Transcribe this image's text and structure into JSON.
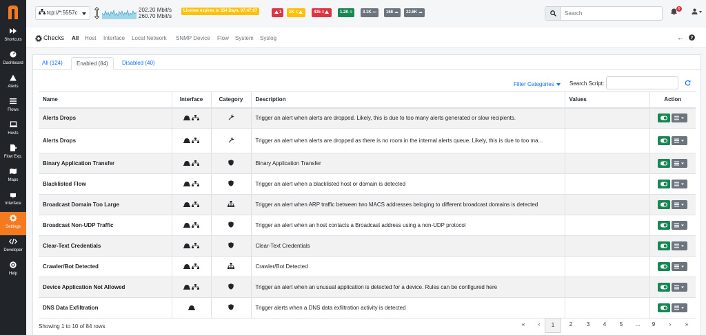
{
  "sidebar": {
    "items": [
      {
        "label": "Shortcuts",
        "icon": "fast-forward-icon"
      },
      {
        "label": "Dashboard",
        "icon": "gauge-icon"
      },
      {
        "label": "Alerts",
        "icon": "warning-icon"
      },
      {
        "label": "Flows",
        "icon": "list-icon"
      },
      {
        "label": "Hosts",
        "icon": "laptop-icon"
      },
      {
        "label": "Flow Exp.",
        "icon": "file-export-icon"
      },
      {
        "label": "Maps",
        "icon": "map-icon"
      },
      {
        "label": "Interface",
        "icon": "ethernet-icon"
      },
      {
        "label": "Settings",
        "icon": "gear-icon"
      },
      {
        "label": "Developer",
        "icon": "code-icon"
      },
      {
        "label": "Help",
        "icon": "lifebuoy-icon"
      }
    ],
    "active": "Settings"
  },
  "topbar": {
    "interface": "tcp://*:5557c",
    "traffic_up": "202.20 Mbit/s",
    "traffic_down": "260.70 Mbit/s",
    "license": "License expires in 354 Days, 07:47:07",
    "badges": [
      "1",
      "1K",
      "435",
      "1.2K",
      "3.1K",
      "168",
      "22.6K"
    ],
    "search_placeholder": "Search",
    "notification_count": "6"
  },
  "nav": {
    "title": "Checks",
    "links": [
      "All",
      "Host",
      "Interface",
      "Local Network",
      "SNMP Device",
      "Flow",
      "System",
      "Syslog"
    ],
    "active": "All"
  },
  "tabs": [
    "All (124)",
    "Enabled (84)",
    "Disabled (40)"
  ],
  "active_tab": "Enabled (84)",
  "filter_categories": "Filter Categories",
  "search_script_label": "Search Script:",
  "table": {
    "headers": [
      "Name",
      "Interface",
      "Category",
      "Description",
      "Values",
      "Action"
    ],
    "rows": [
      {
        "name": "Alerts Drops",
        "interface": "both",
        "category": "wrench-icon",
        "description": "Trigger an alert when alerts are dropped. Likely, this is due to too many alerts generated or slow recipients."
      },
      {
        "name": "Alerts Drops",
        "interface": "both",
        "category": "wrench-icon",
        "description": "Trigger an alert when alerts are dropped as there is no room in the internal alerts queue. Likely, this is due to too ma..."
      },
      {
        "name": "Binary Application Transfer",
        "interface": "both",
        "category": "shield-icon",
        "description": "Binary Application Transfer"
      },
      {
        "name": "Blacklisted Flow",
        "interface": "both",
        "category": "shield-icon",
        "description": "Trigger an alert when a blacklisted host or domain is detected"
      },
      {
        "name": "Broadcast Domain Too Large",
        "interface": "both",
        "category": "network-icon",
        "description": "Trigger an alert when ARP traffic between two MACS addresses beloging to different broadcast domains is detected"
      },
      {
        "name": "Broadcast Non-UDP Traffic",
        "interface": "both",
        "category": "shield-icon",
        "description": "Trigger an alert when an host contacts a Broadcast address using a non-UDP protocol"
      },
      {
        "name": "Clear-Text Credentials",
        "interface": "both",
        "category": "shield-icon",
        "description": "Clear-Text Credentials"
      },
      {
        "name": "Crawler/Bot Detected",
        "interface": "both",
        "category": "network-icon",
        "description": "Crawler/Bot Detected"
      },
      {
        "name": "Device Application Not Allowed",
        "interface": "both",
        "category": "shield-icon",
        "description": "Trigger an alert when an unusual application is detected for a device. Rules can be configured here"
      },
      {
        "name": "DNS Data Exfiltration",
        "interface": "pcap",
        "category": "shield-icon",
        "description": "Trigger alerts when a DNS data exfiltration activity is detected"
      }
    ]
  },
  "footer": {
    "showing": "Showing 1 to 10 of 84 rows",
    "pages": [
      "«",
      "‹",
      "1",
      "2",
      "3",
      "4",
      "5",
      "...",
      "9",
      "›",
      "»"
    ],
    "active_page": "1"
  },
  "colors": {
    "brand": "#f47a20",
    "sidebar": "#212529",
    "link": "#0d6efd",
    "success": "#198754"
  }
}
